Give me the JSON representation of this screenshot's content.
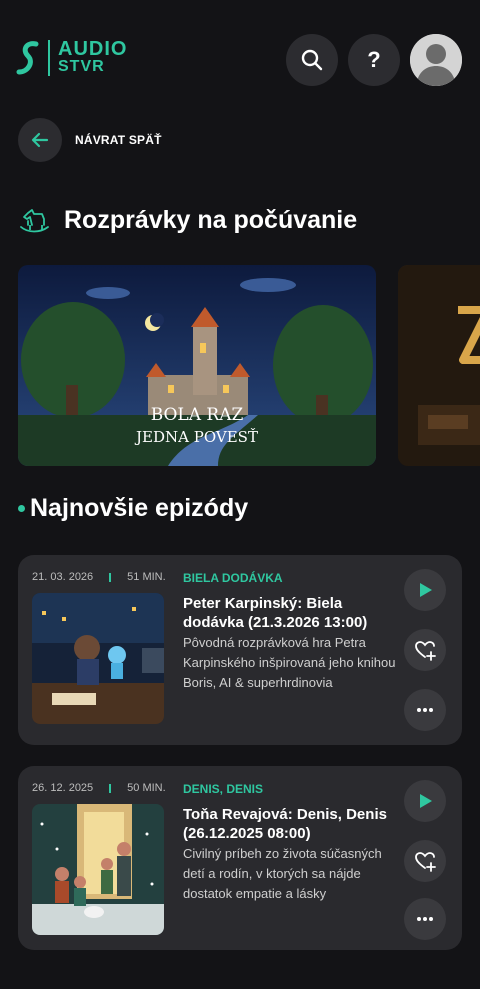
{
  "header": {
    "logo_line1": "AUDIO",
    "logo_line2": "STVR",
    "search_icon": "search-icon",
    "help_label": "?",
    "avatar_icon": "user-avatar"
  },
  "back": {
    "label": "NÁVRAT SPÄŤ"
  },
  "section_fairytales": {
    "title": "Rozprávky na počúvanie",
    "icon": "rocking-horse-icon"
  },
  "carousel": {
    "cards": [
      {
        "caption_line1": "BOLA RAZ",
        "caption_line2": "JEDNA POVESŤ"
      }
    ]
  },
  "section_latest": {
    "title": "Najnovšie epizódy"
  },
  "episodes": [
    {
      "date": "21. 03. 2026",
      "duration": "51 MIN.",
      "category": "BIELA DODÁVKA",
      "title": "Peter Karpinský: Biela dodávka (21.3.2026 13:00)",
      "description": "Pôvodná rozprávková hra Petra Karpinského inšpirovaná jeho knihou Boris, AI & superhrdinovia"
    },
    {
      "date": "26. 12. 2025",
      "duration": "50 MIN.",
      "category": "DENIS, DENIS",
      "title": "Toňa Revajová: Denis, Denis (26.12.2025 08:00)",
      "description": "Civilný príbeh zo života súčasných detí a rodín, v ktorých sa nájde dostatok empatie a lásky"
    }
  ],
  "colors": {
    "accent": "#2fc7a0",
    "background": "#131316",
    "card": "#2a2a2e"
  }
}
